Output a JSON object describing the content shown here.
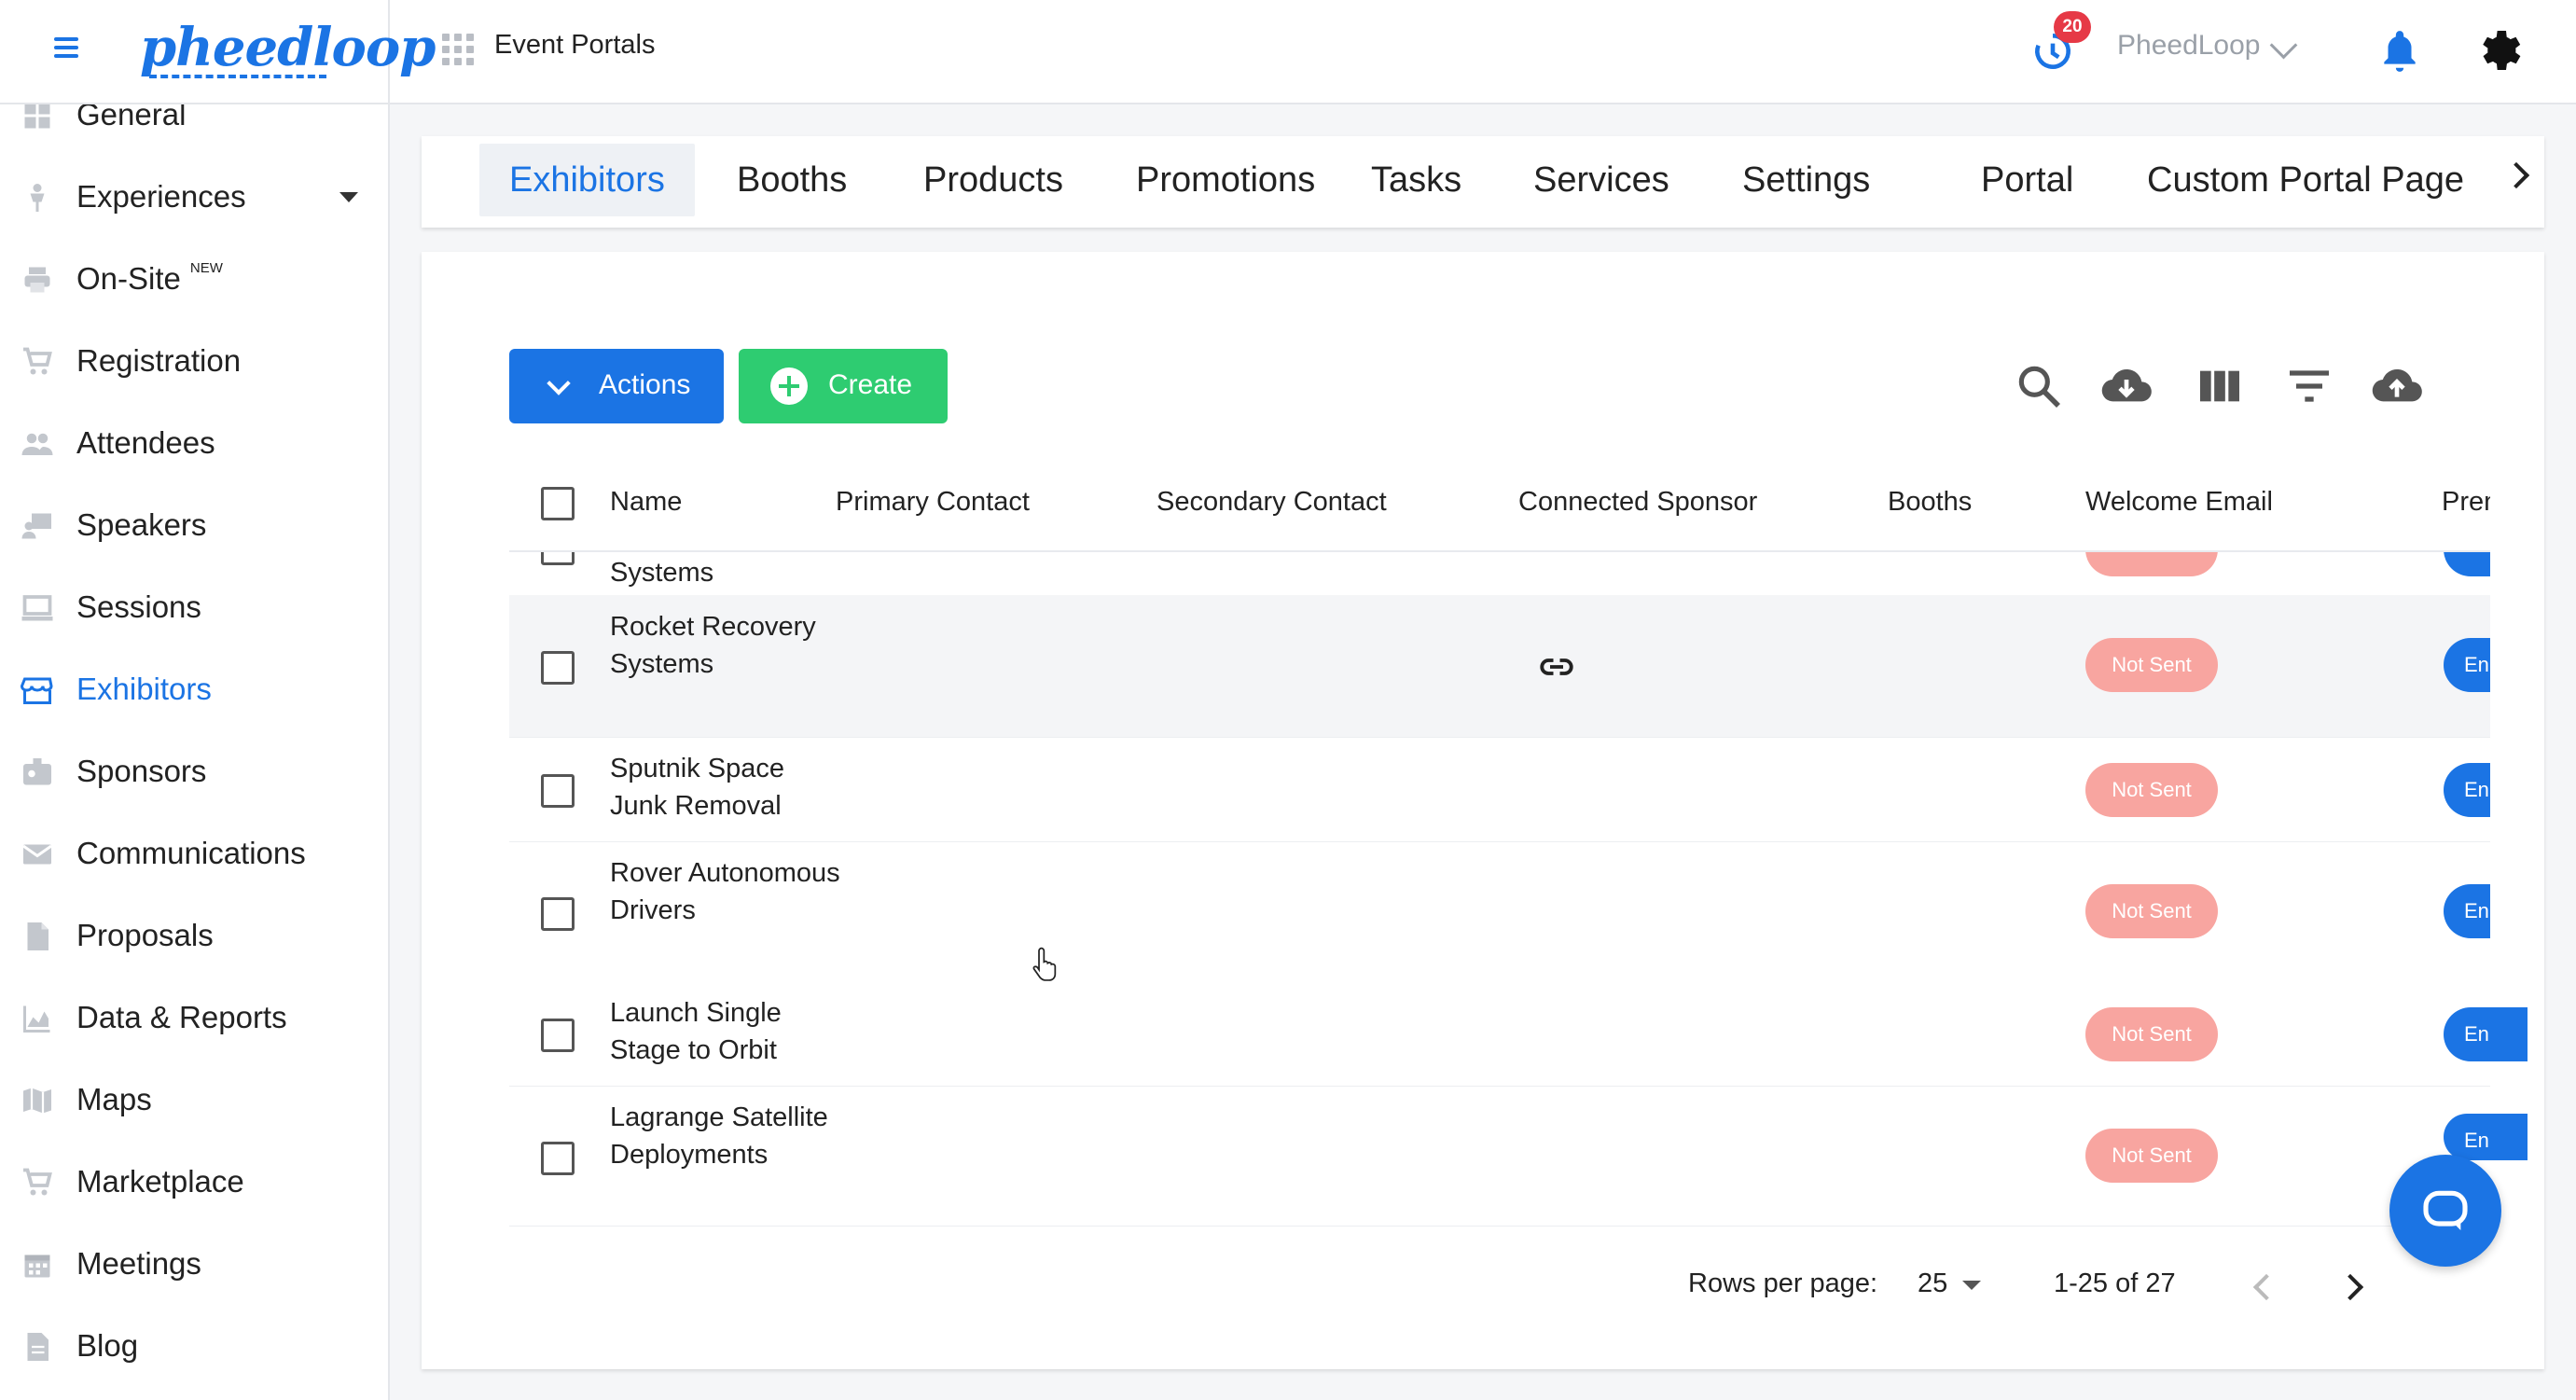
{
  "brand": {
    "logo_text": "pheedloop"
  },
  "header": {
    "portal_title": "Event Portals",
    "notification_count": "20",
    "org_name": "PheedLoop"
  },
  "sidebar": {
    "items": [
      {
        "label": "General",
        "icon": "grid-icon"
      },
      {
        "label": "Experiences",
        "icon": "person-icon"
      },
      {
        "label": "On-Site",
        "sup": "NEW",
        "icon": "printer-icon"
      },
      {
        "label": "Registration",
        "icon": "cart-icon"
      },
      {
        "label": "Attendees",
        "icon": "people-icon"
      },
      {
        "label": "Speakers",
        "icon": "speaker-icon"
      },
      {
        "label": "Sessions",
        "icon": "laptop-icon"
      },
      {
        "label": "Exhibitors",
        "icon": "storefront-icon"
      },
      {
        "label": "Sponsors",
        "icon": "badge-icon"
      },
      {
        "label": "Communications",
        "icon": "mail-icon"
      },
      {
        "label": "Proposals",
        "icon": "document-icon"
      },
      {
        "label": "Data & Reports",
        "icon": "chart-icon"
      },
      {
        "label": "Maps",
        "icon": "map-icon"
      },
      {
        "label": "Marketplace",
        "icon": "cart-icon"
      },
      {
        "label": "Meetings",
        "icon": "calendar-icon"
      },
      {
        "label": "Blog",
        "icon": "document-icon"
      }
    ]
  },
  "tabs": [
    "Exhibitors",
    "Booths",
    "Products",
    "Promotions",
    "Tasks",
    "Services",
    "Settings",
    "Portal",
    "Custom Portal Page"
  ],
  "toolbar": {
    "actions_label": "Actions",
    "create_label": "Create"
  },
  "table": {
    "columns": [
      "Name",
      "Primary Contact",
      "Secondary Contact",
      "Connected Sponsor",
      "Booths",
      "Welcome Email",
      "Pren"
    ],
    "rows": [
      {
        "name": "Systems",
        "partial": true
      },
      {
        "name": "Rocket Recovery Systems",
        "sponsor_link": true,
        "welcome": "Not Sent",
        "action": "En"
      },
      {
        "name": "Sputnik Space Junk Removal",
        "welcome": "Not Sent",
        "action": "En"
      },
      {
        "name": "Rover Autonomous Drivers",
        "welcome": "Not Sent",
        "action": "En"
      },
      {
        "name": "Launch Single Stage to Orbit",
        "welcome": "Not Sent",
        "action": "En"
      },
      {
        "name": "Lagrange Satellite Deployments",
        "welcome": "Not Sent",
        "action": "En"
      }
    ]
  },
  "pagination": {
    "rows_per_page_label": "Rows per page:",
    "rows_per_page": "25",
    "range": "1-25 of 27"
  },
  "colors": {
    "primary": "#1b74e4",
    "success": "#2ecc71",
    "not_sent": "#f8a5a0"
  }
}
